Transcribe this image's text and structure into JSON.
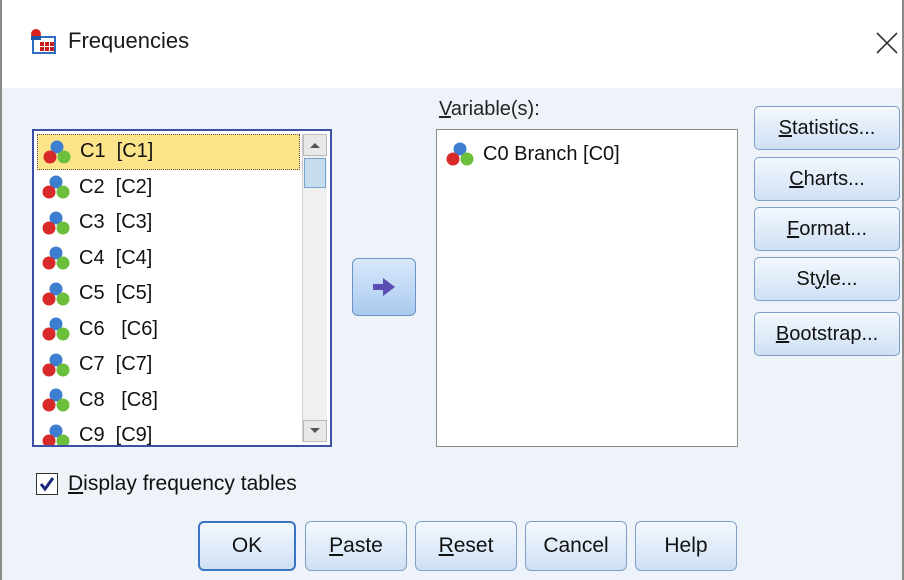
{
  "window": {
    "title": "Frequencies",
    "icon": "frequencies-app-icon",
    "close_icon": "close-icon"
  },
  "source_list": {
    "items": [
      {
        "label": "C1  [C1]",
        "selected": true
      },
      {
        "label": "C2  [C2]"
      },
      {
        "label": "C3  [C3]"
      },
      {
        "label": "C4  [C4]"
      },
      {
        "label": "C5  [C5]"
      },
      {
        "label": "C6   [C6]"
      },
      {
        "label": "C7  [C7]"
      },
      {
        "label": "C8   [C8]"
      },
      {
        "label": "C9  [C9]"
      }
    ],
    "item_icon": "nominal-variable-icon"
  },
  "move_button": {
    "icon": "arrow-right-icon"
  },
  "target": {
    "label": "Variable(s):",
    "items": [
      {
        "label": "C0 Branch [C0]"
      }
    ]
  },
  "side_buttons": {
    "statistics": {
      "pre": "",
      "key": "S",
      "post": "tatistics..."
    },
    "charts": {
      "pre": "",
      "key": "C",
      "post": "harts..."
    },
    "format": {
      "pre": "",
      "key": "F",
      "post": "ormat..."
    },
    "style": {
      "pre": "St",
      "key": "y",
      "post": "le..."
    },
    "bootstrap": {
      "pre": "",
      "key": "B",
      "post": "ootstrap..."
    }
  },
  "display_tables": {
    "checked": true,
    "pre": "",
    "key": "D",
    "post": "isplay frequency tables"
  },
  "bottom_buttons": {
    "ok": {
      "label": "OK"
    },
    "paste": {
      "key": "P",
      "post": "aste"
    },
    "reset": {
      "key": "R",
      "post": "eset"
    },
    "cancel": {
      "label": "Cancel"
    },
    "help": {
      "label": "Help"
    }
  },
  "colors": {
    "dialog_bg": "#eef3fa",
    "selection": "#fce48a",
    "list_border": "#3b4fa8",
    "button_border": "#7f9fc8"
  }
}
